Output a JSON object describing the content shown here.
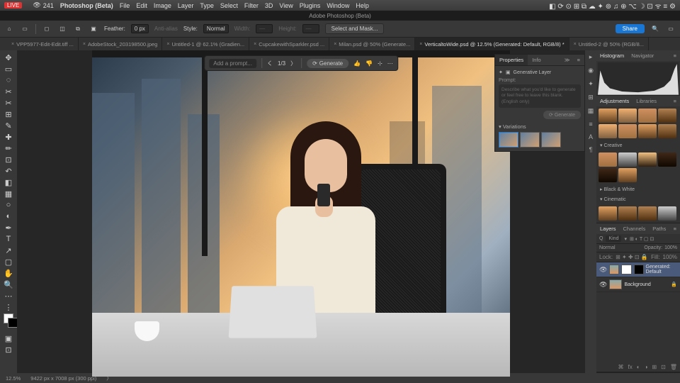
{
  "mac_menu": {
    "app": "Photoshop (Beta)",
    "items": [
      "File",
      "Edit",
      "Image",
      "Layer",
      "Type",
      "Select",
      "Filter",
      "3D",
      "View",
      "Plugins",
      "Window",
      "Help"
    ],
    "live": "LIVE",
    "viewers": "241"
  },
  "title": "Adobe Photoshop (Beta)",
  "options": {
    "feather_label": "Feather:",
    "feather_val": "0 px",
    "style_label": "Style:",
    "style_val": "Normal",
    "select_mask": "Select and Mask...",
    "share": "Share"
  },
  "tabs": [
    {
      "label": "VPP5977-Edit-Edit.tiff ..."
    },
    {
      "label": "AdobeStock_203198500.jpeg"
    },
    {
      "label": "Untitled-1 @ 62.1% (Gradien..."
    },
    {
      "label": "CupcakewithSparkler.psd ..."
    },
    {
      "label": "Milan.psd @ 50% (Generate..."
    },
    {
      "label": "VerticaltoWide.psd @ 12.5% (Generated: Default, RGB/8) *",
      "active": true
    },
    {
      "label": "Untitled-2 @ 50% (RGB/8..."
    }
  ],
  "float_bar": {
    "prompt_placeholder": "Add a prompt...",
    "counter": "1/3",
    "generate": "Generate"
  },
  "properties": {
    "tab1": "Properties",
    "tab2": "Info",
    "layer_type": "Generative Layer",
    "prompt_label": "Prompt:",
    "prompt_hint": "Describe what you'd like to generate or feel free to leave this blank. (English only)",
    "generate": "Generate",
    "variations": "Variations"
  },
  "right": {
    "histogram": "Histogram",
    "navigator": "Navigator",
    "adjustments": "Adjustments",
    "libraries": "Libraries",
    "creative": "Creative",
    "bw": "Black & White",
    "cinematic": "Cinematic"
  },
  "layers": {
    "tab1": "Layers",
    "tab2": "Channels",
    "tab3": "Paths",
    "kind": "Kind",
    "blend": "Normal",
    "opacity_label": "Opacity:",
    "opacity": "100%",
    "lock": "Lock:",
    "fill_label": "Fill:",
    "fill": "100%",
    "items": [
      {
        "name": "Generated: Default",
        "sel": true
      },
      {
        "name": "Background"
      }
    ]
  },
  "status": {
    "zoom": "12.5%",
    "dim": "9422 px x 7008 px (300 ppi)"
  }
}
